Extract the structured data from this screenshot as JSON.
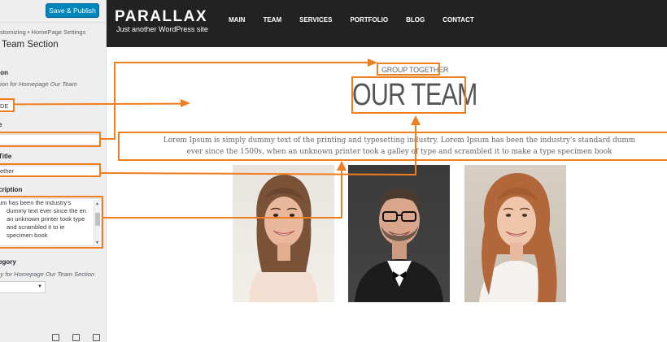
{
  "customizer": {
    "publish_label": "Save & Publish",
    "breadcrumb": "ıstomizing • HomePage Settings",
    "section_title": "ır Team Section",
    "controls": [
      {
        "label": "ion",
        "desc": "tion for Homepage Our Team",
        "value": "DE"
      },
      {
        "label": "e",
        "value": ""
      },
      {
        "label": "Title",
        "value": "ether"
      },
      {
        "label": "cription",
        "value": "um has been the industry's dummy text ever since the en an unknown printer took type and scrambled it to ie specimen book"
      },
      {
        "label": "egory",
        "desc": "ry for Homepage Our Team Section",
        "value": ""
      }
    ]
  },
  "site": {
    "logo": "PARALLAX",
    "tagline": "Just another WordPress site",
    "nav": [
      "MAIN",
      "TEAM",
      "SERVICES",
      "PORTFOLIO",
      "BLOG",
      "CONTACT"
    ]
  },
  "team_section": {
    "kicker": "GROUP TOGETHER",
    "title": "OUR TEAM",
    "description_line1": "Lorem Ipsum is simply dummy text of the printing and typesetting industry. Lorem Ipsum has been the industry's standard dumm",
    "description_line2": "ever since the 1500s, when an unknown printer took a galley of type and scrambled it to make a type specimen book"
  },
  "colors": {
    "annotation": "#f07d1e",
    "header": "#222222",
    "publish": "#0085ba"
  }
}
